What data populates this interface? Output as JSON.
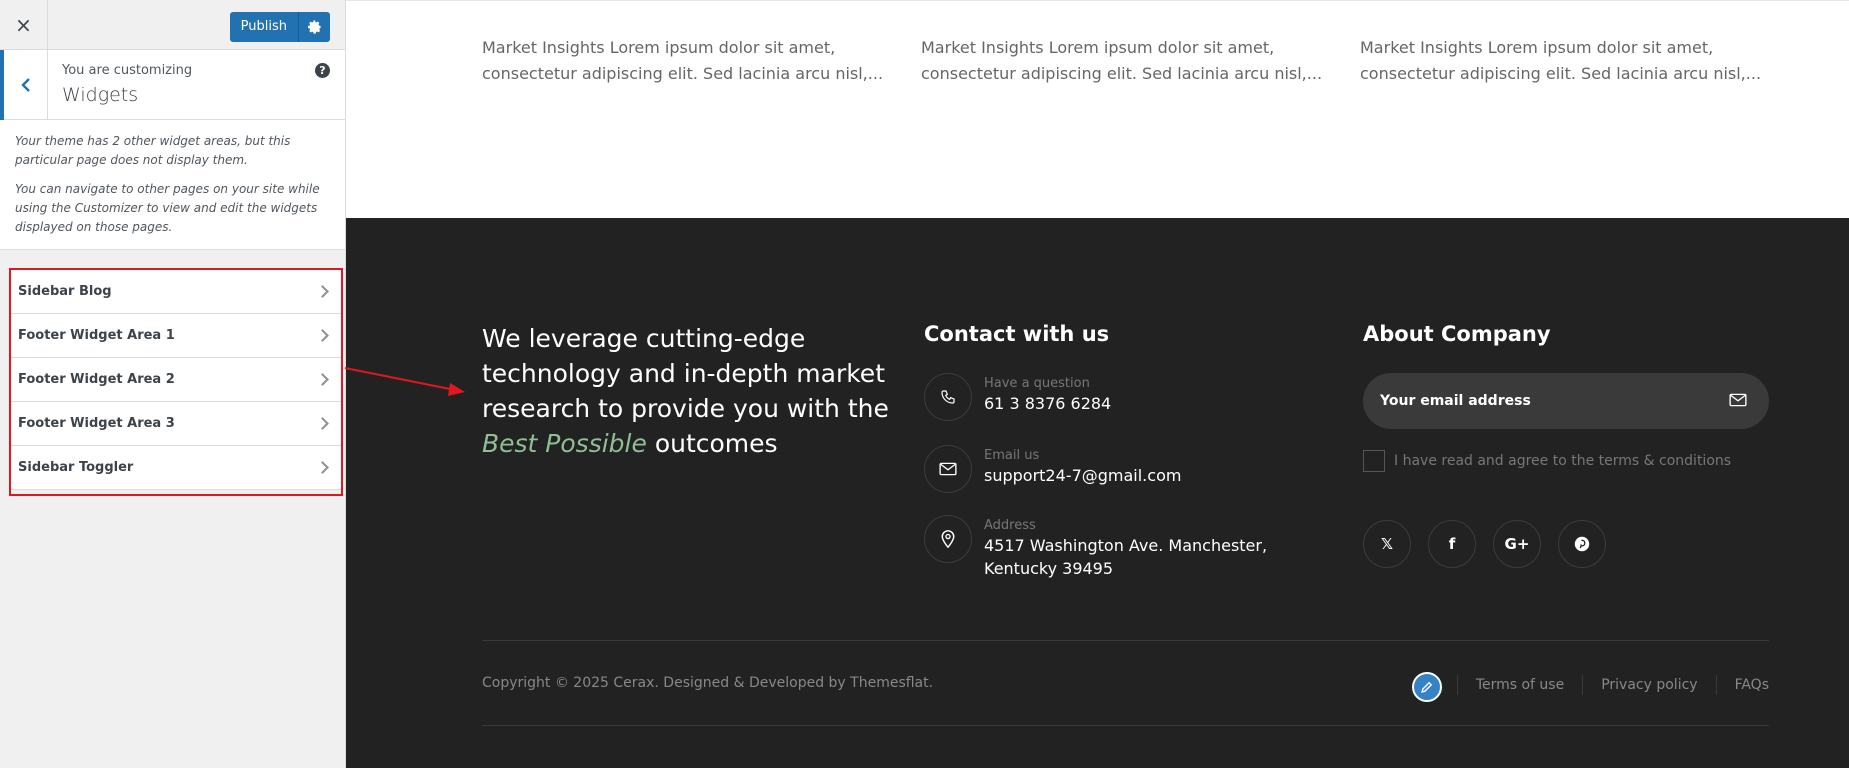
{
  "customizer": {
    "close_icon": "×",
    "publish_label": "Publish",
    "customizing_label": "You are customizing",
    "section_title": "Widgets",
    "help_icon": "?",
    "description": [
      "Your theme has 2 other widget areas, but this particular page does not display them.",
      "You can navigate to other pages on your site while using the Customizer to view and edit the widgets displayed on those pages."
    ],
    "widget_areas": [
      {
        "label": "Sidebar Blog"
      },
      {
        "label": "Footer Widget Area 1"
      },
      {
        "label": "Footer Widget Area 2"
      },
      {
        "label": "Footer Widget Area 3"
      },
      {
        "label": "Sidebar Toggler"
      }
    ],
    "accent_color": "#2271b1",
    "highlight_color": "#e0171f"
  },
  "preview": {
    "insights": [
      {
        "line1": "Market Insights Lorem ipsum dolor sit amet,",
        "line2": "consectetur adipiscing elit. Sed lacinia arcu nisl,..."
      },
      {
        "line1": "Market Insights Lorem ipsum dolor sit amet,",
        "line2": "consectetur adipiscing elit. Sed lacinia arcu nisl,..."
      },
      {
        "line1": "Market Insights Lorem ipsum dolor sit amet,",
        "line2": "consectetur adipiscing elit. Sed lacinia arcu nisl,..."
      }
    ],
    "footer": {
      "tagline_main": "We leverage cutting-edge technology and in-depth market research to provide you with the ",
      "tagline_accent": "Best Possible",
      "tagline_end": " outcomes",
      "contact_title": "Contact with us",
      "contacts": [
        {
          "icon": "phone-icon",
          "label": "Have a question",
          "value": "61 3 8376 6284"
        },
        {
          "icon": "mail-icon",
          "label": "Email us",
          "value": "support24-7@gmail.com"
        },
        {
          "icon": "location-icon",
          "label": "Address",
          "value": "4517 Washington Ave. Manchester,",
          "value2": "Kentucky 39495"
        }
      ],
      "about_title": "About Company",
      "email_placeholder": "Your email address",
      "agree_text": "I have read and agree to the terms & conditions",
      "socials": [
        {
          "icon": "x-icon",
          "glyph": "𝕏"
        },
        {
          "icon": "facebook-icon",
          "glyph": "f"
        },
        {
          "icon": "google-plus-icon",
          "glyph": "G+"
        },
        {
          "icon": "pinterest-icon",
          "glyph": "P"
        }
      ],
      "copyright": "Copyright © 2025 Cerax. Designed & Developed by Themesflat.",
      "links": [
        "Terms of use",
        "Privacy policy",
        "FAQs"
      ],
      "accent_color": "#8fbf94",
      "background": "#222222"
    }
  }
}
